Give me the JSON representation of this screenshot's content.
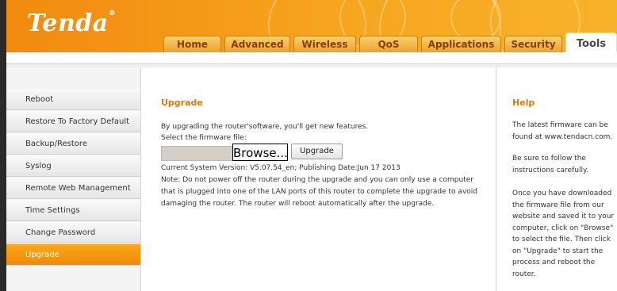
{
  "brand": {
    "logo": "Tenda",
    "registered": "®"
  },
  "nav": {
    "tabs": [
      {
        "label": "Home"
      },
      {
        "label": "Advanced"
      },
      {
        "label": "Wireless"
      },
      {
        "label": "QoS"
      },
      {
        "label": "Applications"
      },
      {
        "label": "Security"
      },
      {
        "label": "Tools"
      }
    ],
    "active": "Tools"
  },
  "sidebar": {
    "items": [
      {
        "label": "Reboot"
      },
      {
        "label": "Restore To Factory Default"
      },
      {
        "label": "Backup/Restore"
      },
      {
        "label": "Syslog"
      },
      {
        "label": "Remote Web Management"
      },
      {
        "label": "Time Settings"
      },
      {
        "label": "Change Password"
      },
      {
        "label": "Upgrade"
      }
    ],
    "active": "Upgrade"
  },
  "main": {
    "title": "Upgrade",
    "intro": "By upgrading the router'software, you'll get new features.",
    "select_label": "Select the firmware file:",
    "browse_label": "Browse...",
    "upgrade_label": "Upgrade",
    "version": "Current System Version: V5.07.54_en; Publishing Date:Jun 17 2013",
    "note_lines": [
      "Note: Do not power off the router during the upgrade and you can only use a computer",
      "that is plugged into one of the LAN ports of this router to complete the upgrade to avoid",
      "damaging the router. The router will reboot automatically after the upgrade."
    ]
  },
  "help": {
    "title": "Help",
    "p1": "The latest firmware can be found at www.tendacn.com.",
    "p2": "Be sure to follow the instructions carefully.",
    "p3": "Once you have downloaded the firmware file from our website and saved it to your computer, click on \"Browse\" to select the file. Then click on \"Upgrade\" to start the process and reboot the router."
  },
  "colors": {
    "accent": "#f39a14",
    "title": "#e07a06",
    "tab_text": "#8a3d0c"
  }
}
